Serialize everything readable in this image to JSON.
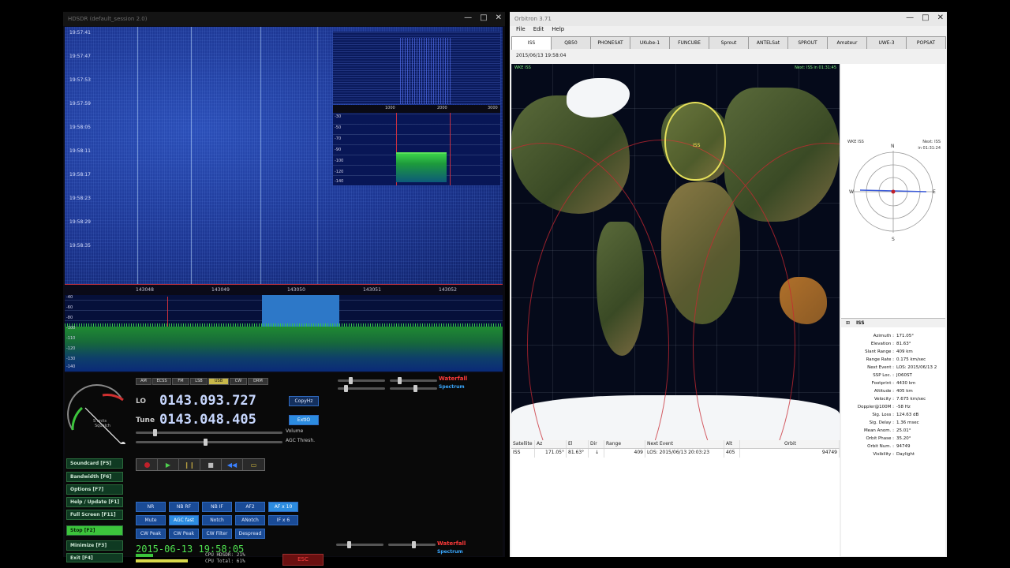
{
  "hdsdr": {
    "title": "HDSDR (default_session 2.0)",
    "waterfall_times": [
      "19:57:41",
      "19:57:47",
      "19:57:53",
      "19:57:59",
      "19:58:05",
      "19:58:11",
      "19:58:17",
      "19:58:23",
      "19:58:29",
      "19:58:35"
    ],
    "freq_ticks": [
      "143048",
      "143049",
      "143050",
      "143051",
      "143052"
    ],
    "db_ticks": [
      "-40",
      "-60",
      "-80",
      "-100",
      "-110",
      "-120",
      "-130",
      "-140"
    ],
    "lo_label": "LO",
    "lo_value": "0143.093.727",
    "tune_label": "Tune",
    "tune_value": "0143.048.405",
    "lo_button": "ExtIO",
    "tune_button": "ExtIO",
    "copy_button": "CopyHz",
    "volume_label": "Volume",
    "agc_label": "AGC Thresh.",
    "smeter_unit": "S units",
    "smeter_hint": "Squelch",
    "mode_buttons": [
      "AM",
      "ECSS",
      "FM",
      "LSB",
      "USB",
      "CW",
      "DRM"
    ],
    "side_buttons": [
      {
        "label": "Soundcard",
        "key": "[F5]"
      },
      {
        "label": "Bandwidth",
        "key": "[F6]"
      },
      {
        "label": "Options",
        "key": "[F7]"
      },
      {
        "label": "Help / Update",
        "key": "[F1]"
      },
      {
        "label": "Full Screen",
        "key": "[F11]"
      },
      {
        "label": "Stop",
        "key": "[F2]"
      },
      {
        "label": "Minimize",
        "key": "[F3]"
      },
      {
        "label": "Exit",
        "key": "[F4]"
      }
    ],
    "dsp_row1": [
      "NR",
      "NB RF",
      "NB IF",
      "AF2",
      "AF x 10"
    ],
    "dsp_row2": [
      "Mute",
      "AGC fast",
      "Notch",
      "ANotch",
      "IF x 6"
    ],
    "dsp_row3": [
      "CW Peak",
      "CW Peak",
      "CW Filter",
      "Despread"
    ],
    "datetime": "2015-06-13 19:58:05",
    "cpu_line1": "CPU HDSDR: 21%",
    "cpu_line2": "CPU Total: 61%",
    "exit_label": "ESC",
    "waterfall_label": "Waterfall",
    "spectrum_label": "Spectrum",
    "zoom_ticks": [
      "-30",
      "-50",
      "-70",
      "-90",
      "-100",
      "-120",
      "-140"
    ],
    "zoom_axis": [
      "1000",
      "2000",
      "3000"
    ]
  },
  "orbitron": {
    "title": "Orbitron 3.71",
    "menu": [
      "File",
      "Edit",
      "Help"
    ],
    "tabs": [
      "ISS",
      "QB50",
      "PHONESAT",
      "UKube-1",
      "FUNCUBE",
      "Sprout",
      "ANTELSat",
      "SPROUT",
      "Amateur",
      "UWE-3",
      "POPSAT"
    ],
    "timestamp": "2015/06/13 19:58:04",
    "map_label_left": "WKE ISS",
    "map_label_right": "Next: ISS in 01:31:45",
    "iss_label": "ISS",
    "radar_label_left": "WKE ISS",
    "radar_label_right": "Next: ISS",
    "radar_label_time": "in 01:31:24",
    "compass": {
      "n": "N",
      "s": "S",
      "e": "E",
      "w": "W"
    },
    "grid_headers": [
      "Satellite",
      "Az",
      "El",
      "Dir",
      "Range",
      "Next Event",
      "Alt",
      "Orbit"
    ],
    "grid_row": [
      "ISS",
      "171.05°",
      "81.63°",
      "↓",
      "409",
      "LOS: 2015/06/13 20:03:23",
      "405",
      "94749"
    ],
    "info_title": "ISS",
    "info": [
      {
        "k": "Azimuth :",
        "v": "171.05°"
      },
      {
        "k": "Elevation :",
        "v": "81.63°"
      },
      {
        "k": "Slant Range :",
        "v": "409 km"
      },
      {
        "k": "Range Rate :",
        "v": "0.175 km/sec"
      },
      {
        "k": "Next Event :",
        "v": "LOS: 2015/06/13 2"
      },
      {
        "k": "SSP Loc. :",
        "v": "JO60ST"
      },
      {
        "k": "Footprint :",
        "v": "4430 km"
      },
      {
        "k": "Altitude :",
        "v": "405 km"
      },
      {
        "k": "Velocity :",
        "v": "7.675 km/sec"
      },
      {
        "k": "Doppler@100M :",
        "v": "-58 Hz"
      },
      {
        "k": "Sig. Loss :",
        "v": "124.63 dB"
      },
      {
        "k": "Sig. Delay :",
        "v": "1.36 msec"
      },
      {
        "k": "Mean Anom. :",
        "v": "25.01°"
      },
      {
        "k": "Orbit Phase :",
        "v": "35.20°"
      },
      {
        "k": "Orbit Num. :",
        "v": "94749"
      },
      {
        "k": "Visibility :",
        "v": "Daylight"
      }
    ]
  }
}
